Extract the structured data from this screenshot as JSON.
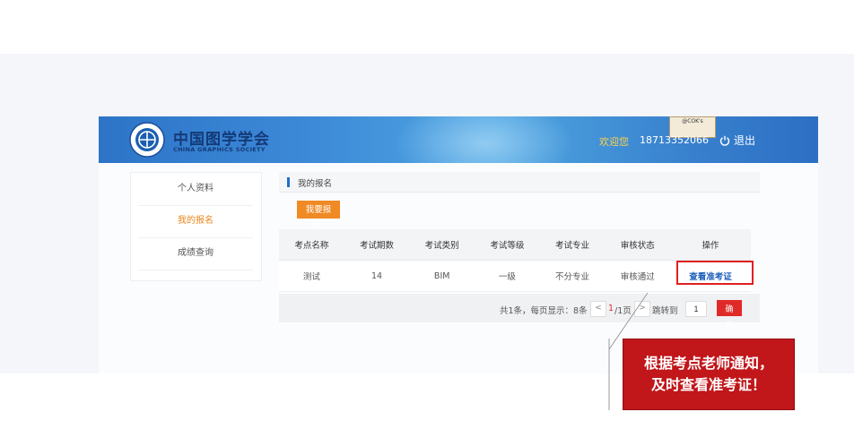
{
  "header": {
    "brand_cn": "中国图学学会",
    "brand_en": "CHINA GRAPHICS SOCIETY",
    "welcome": "欢迎您",
    "phone": "18713352066",
    "logout": "退出",
    "sign_text": "@COK's"
  },
  "sidebar": {
    "items": [
      {
        "label": "个人资料"
      },
      {
        "label": "我的报名"
      },
      {
        "label": "成绩查询"
      }
    ]
  },
  "breadcrumb": "我的报名",
  "register_button": "我要报名",
  "table": {
    "headers": [
      "考点名称",
      "考试期数",
      "考试类别",
      "考试等级",
      "考试专业",
      "审核状态",
      "操作"
    ],
    "rows": [
      {
        "site": "测试",
        "period": "14",
        "category": "BIM",
        "level": "一级",
        "major": "不分专业",
        "status": "审核通过",
        "action": "查看准考证"
      }
    ]
  },
  "pagination": {
    "summary": "共1条，每页显示：8条",
    "prev": "<",
    "current": "1",
    "total": "/1页",
    "next": ">",
    "jump_label": "跳转到",
    "jump_value": "1",
    "confirm": "确定"
  },
  "callout": {
    "line1": "根据考点老师通知，",
    "line2": "及时查看准考证！"
  },
  "colors": {
    "header_blue": "#3d8ad8",
    "accent_orange": "#f08a24",
    "highlight_red": "#e02020",
    "callout_red": "#c1161a"
  }
}
